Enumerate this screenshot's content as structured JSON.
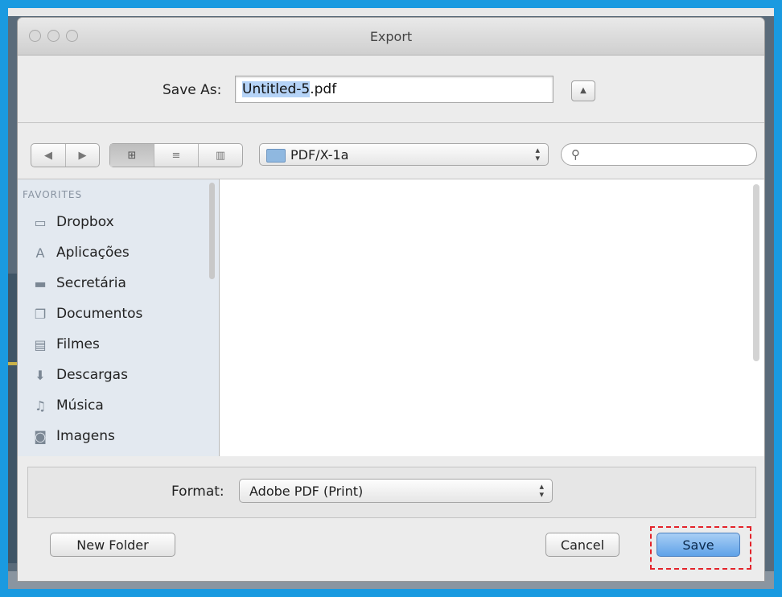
{
  "window": {
    "title": "Export"
  },
  "save_as": {
    "label": "Save As:",
    "filename_selected": "Untitled-5",
    "filename_ext": ".pdf"
  },
  "toolbar": {
    "back_icon": "back-arrow-icon",
    "forward_icon": "forward-arrow-icon",
    "view_modes": [
      "icon-view-icon",
      "list-view-icon",
      "column-view-icon"
    ],
    "location": "PDF/X-1a",
    "search": {
      "placeholder": "",
      "icon": "magnifier-icon"
    }
  },
  "sidebar": {
    "header": "FAVORITES",
    "items": [
      {
        "label": "Dropbox",
        "icon": "folder-icon"
      },
      {
        "label": "Aplicações",
        "icon": "applications-icon"
      },
      {
        "label": "Secretária",
        "icon": "desktop-icon"
      },
      {
        "label": "Documentos",
        "icon": "documents-icon"
      },
      {
        "label": "Filmes",
        "icon": "movies-icon"
      },
      {
        "label": "Descargas",
        "icon": "downloads-icon"
      },
      {
        "label": "Música",
        "icon": "music-icon"
      },
      {
        "label": "Imagens",
        "icon": "pictures-icon"
      }
    ]
  },
  "format": {
    "label": "Format:",
    "value": "Adobe PDF (Print)"
  },
  "buttons": {
    "new_folder": "New Folder",
    "cancel": "Cancel",
    "save": "Save"
  },
  "colors": {
    "accent": "#5fa2e8",
    "highlight": "#e3242b",
    "border": "#1a9ae0"
  }
}
